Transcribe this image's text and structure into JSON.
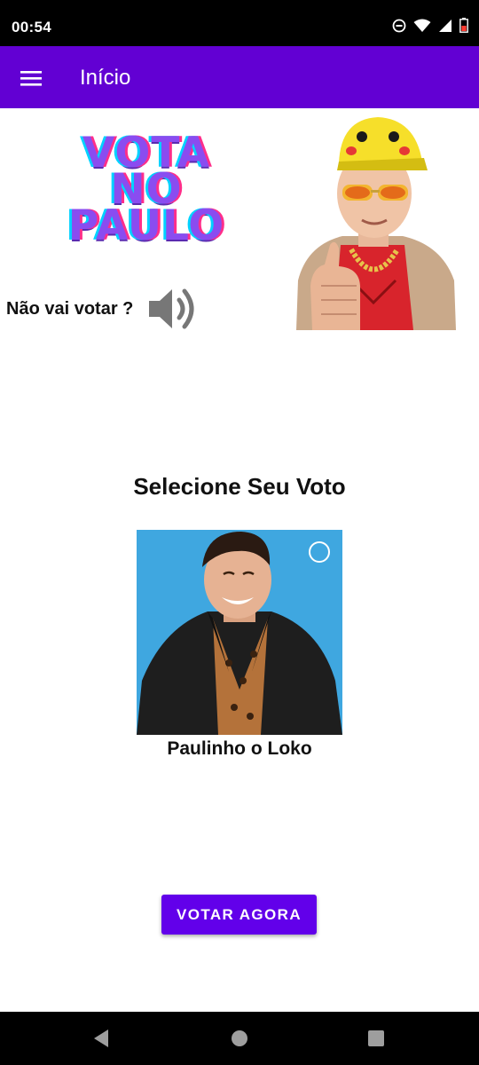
{
  "status_bar": {
    "time": "00:54",
    "icons": [
      "do-not-disturb-icon",
      "wifi-icon",
      "cell-signal-icon",
      "battery-icon"
    ]
  },
  "app_bar": {
    "title": "Início",
    "menu_icon": "hamburger-menu-icon",
    "background": "#6200d3"
  },
  "banner": {
    "lines": [
      "VOTA",
      "NO",
      "PAULO"
    ]
  },
  "sticker": {
    "icon": "thumbs-up-guy-sticker"
  },
  "question": {
    "text": "Não vai votar ?",
    "sound_icon": "speaker-icon"
  },
  "selection": {
    "title": "Selecione Seu Voto",
    "candidate": {
      "name": "Paulinho o Loko",
      "selected": false
    }
  },
  "actions": {
    "vote_label": "VOTAR AGORA",
    "accent": "#6200ea"
  },
  "nav": {
    "icons": [
      "back-icon",
      "home-icon",
      "recents-icon"
    ]
  }
}
